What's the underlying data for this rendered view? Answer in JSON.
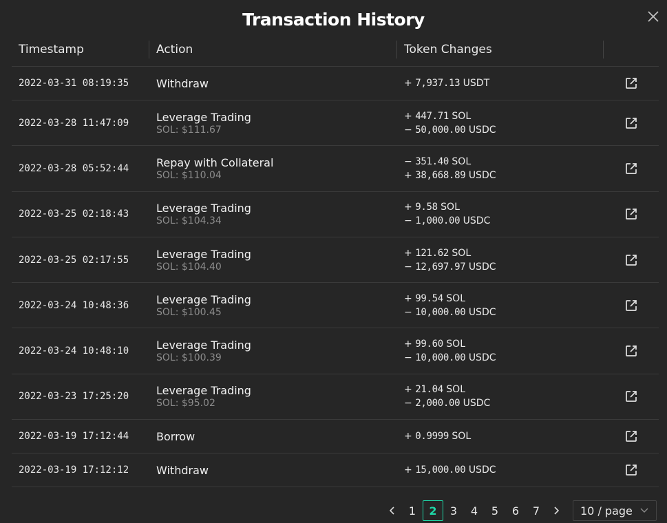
{
  "modal": {
    "title": "Transaction History"
  },
  "table": {
    "headers": [
      "Timestamp",
      "Action",
      "Token Changes"
    ],
    "rows": [
      {
        "timestamp": "2022-03-31 08:19:35",
        "action": "Withdraw",
        "sub": "",
        "changes": [
          {
            "sign": "+",
            "amount": "7,937.13",
            "token": "USDT"
          }
        ]
      },
      {
        "timestamp": "2022-03-28 11:47:09",
        "action": "Leverage Trading",
        "sub": "SOL: $111.67",
        "changes": [
          {
            "sign": "+",
            "amount": "447.71",
            "token": "SOL"
          },
          {
            "sign": "−",
            "amount": "50,000.00",
            "token": "USDC"
          }
        ]
      },
      {
        "timestamp": "2022-03-28 05:52:44",
        "action": "Repay with Collateral",
        "sub": "SOL: $110.04",
        "changes": [
          {
            "sign": "−",
            "amount": "351.40",
            "token": "SOL"
          },
          {
            "sign": "+",
            "amount": "38,668.89",
            "token": "USDC"
          }
        ]
      },
      {
        "timestamp": "2022-03-25 02:18:43",
        "action": "Leverage Trading",
        "sub": "SOL: $104.34",
        "changes": [
          {
            "sign": "+",
            "amount": "9.58",
            "token": "SOL"
          },
          {
            "sign": "−",
            "amount": "1,000.00",
            "token": "USDC"
          }
        ]
      },
      {
        "timestamp": "2022-03-25 02:17:55",
        "action": "Leverage Trading",
        "sub": "SOL: $104.40",
        "changes": [
          {
            "sign": "+",
            "amount": "121.62",
            "token": "SOL"
          },
          {
            "sign": "−",
            "amount": "12,697.97",
            "token": "USDC"
          }
        ]
      },
      {
        "timestamp": "2022-03-24 10:48:36",
        "action": "Leverage Trading",
        "sub": "SOL: $100.45",
        "changes": [
          {
            "sign": "+",
            "amount": "99.54",
            "token": "SOL"
          },
          {
            "sign": "−",
            "amount": "10,000.00",
            "token": "USDC"
          }
        ]
      },
      {
        "timestamp": "2022-03-24 10:48:10",
        "action": "Leverage Trading",
        "sub": "SOL: $100.39",
        "changes": [
          {
            "sign": "+",
            "amount": "99.60",
            "token": "SOL"
          },
          {
            "sign": "−",
            "amount": "10,000.00",
            "token": "USDC"
          }
        ]
      },
      {
        "timestamp": "2022-03-23 17:25:20",
        "action": "Leverage Trading",
        "sub": "SOL: $95.02",
        "changes": [
          {
            "sign": "+",
            "amount": "21.04",
            "token": "SOL"
          },
          {
            "sign": "−",
            "amount": "2,000.00",
            "token": "USDC"
          }
        ]
      },
      {
        "timestamp": "2022-03-19 17:12:44",
        "action": "Borrow",
        "sub": "",
        "changes": [
          {
            "sign": "+",
            "amount": "0.9999",
            "token": "SOL"
          }
        ]
      },
      {
        "timestamp": "2022-03-19 17:12:12",
        "action": "Withdraw",
        "sub": "",
        "changes": [
          {
            "sign": "+",
            "amount": "15,000.00",
            "token": "USDC"
          }
        ]
      }
    ]
  },
  "pagination": {
    "pages": [
      "1",
      "2",
      "3",
      "4",
      "5",
      "6",
      "7"
    ],
    "current": "2",
    "page_size": "10 / page",
    "accent": "#1fd8a8"
  },
  "icons": {
    "close": "close-icon",
    "external": "external-link-icon",
    "prev": "chevron-left-icon",
    "next": "chevron-right-icon",
    "dropdown": "chevron-down-icon"
  }
}
